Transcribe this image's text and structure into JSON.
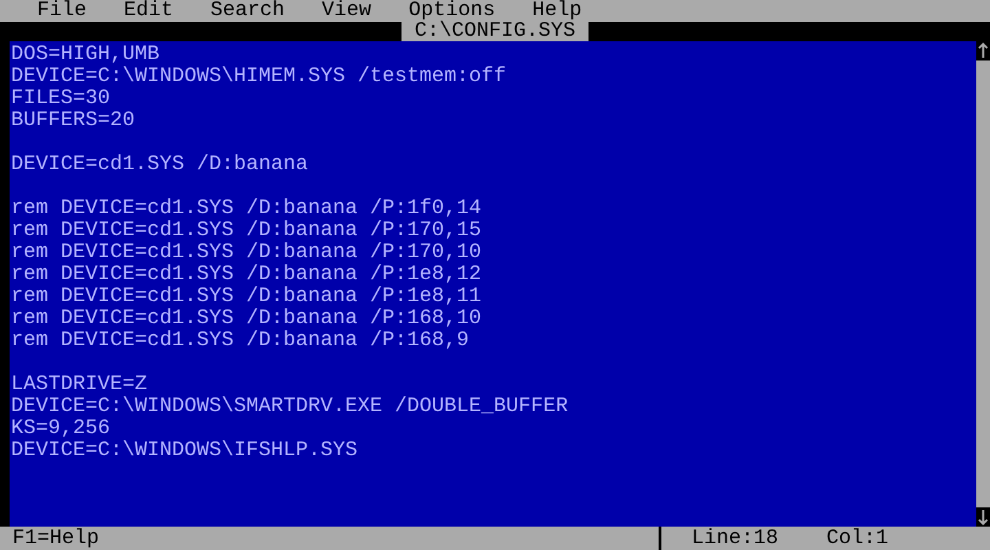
{
  "menu": [
    "File",
    "Edit",
    "Search",
    "View",
    "Options",
    "Help"
  ],
  "window": {
    "title": "C:\\CONFIG.SYS"
  },
  "lines": [
    {
      "kind": "text",
      "text": "DOS=HIGH,UMB"
    },
    {
      "kind": "text",
      "text": "DEVICE=C:\\WINDOWS\\HIMEM.SYS /testmem:off"
    },
    {
      "kind": "text",
      "text": "FILES=30"
    },
    {
      "kind": "text",
      "text": "BUFFERS=20"
    },
    {
      "kind": "blank"
    },
    {
      "kind": "text",
      "text": "DEVICE=cd1.SYS /D:banana"
    },
    {
      "kind": "blank"
    },
    {
      "kind": "text",
      "text": "rem DEVICE=cd1.SYS /D:banana /P:1f0,14"
    },
    {
      "kind": "text",
      "text": "rem DEVICE=cd1.SYS /D:banana /P:170,15"
    },
    {
      "kind": "text",
      "text": "rem DEVICE=cd1.SYS /D:banana /P:170,10"
    },
    {
      "kind": "text",
      "text": "rem DEVICE=cd1.SYS /D:banana /P:1e8,12"
    },
    {
      "kind": "text",
      "text": "rem DEVICE=cd1.SYS /D:banana /P:1e8,11"
    },
    {
      "kind": "text",
      "text": "rem DEVICE=cd1.SYS /D:banana /P:168,10"
    },
    {
      "kind": "text",
      "text": "rem DEVICE=cd1.SYS /D:banana /P:168,9"
    },
    {
      "kind": "blank"
    },
    {
      "kind": "text",
      "text": "LASTDRIVE=Z"
    },
    {
      "kind": "text",
      "text": "DEVICE=C:\\WINDOWS\\SMARTDRV.EXE /DOUBLE_BUFFER"
    },
    {
      "kind": "text",
      "text": "KS=9,256"
    },
    {
      "kind": "text",
      "text": "DEVICE=C:\\WINDOWS\\IFSHLP.SYS"
    }
  ],
  "status_bar": {
    "help": "F1=Help",
    "line": "Line:18",
    "col": "Col:1"
  }
}
